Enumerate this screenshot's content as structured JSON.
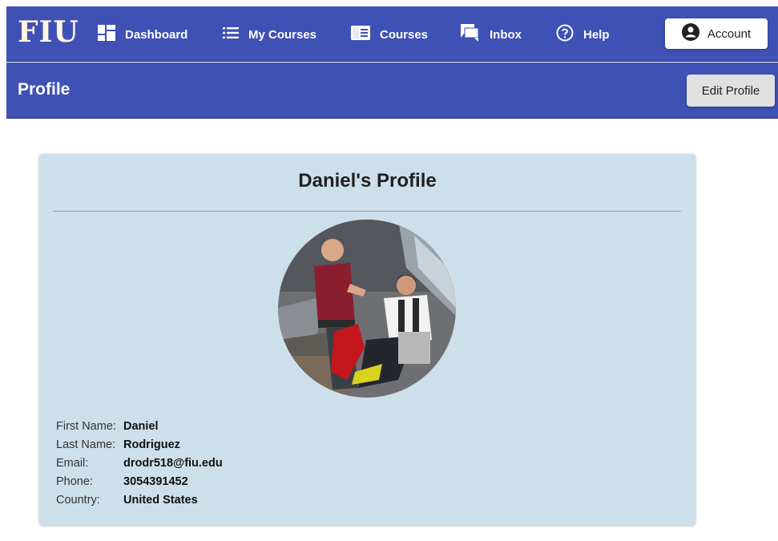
{
  "header": {
    "logo": "FIU",
    "nav": [
      {
        "label": "Dashboard",
        "icon": "dashboard-icon"
      },
      {
        "label": "My Courses",
        "icon": "list-icon"
      },
      {
        "label": "Courses",
        "icon": "courses-icon"
      },
      {
        "label": "Inbox",
        "icon": "inbox-icon"
      },
      {
        "label": "Help",
        "icon": "help-icon"
      }
    ],
    "account_label": "Account"
  },
  "subheader": {
    "title": "Profile",
    "edit_label": "Edit Profile"
  },
  "profile": {
    "heading": "Daniel's Profile",
    "photo": "profile-photo",
    "fields": [
      {
        "label": "First Name:",
        "value": "Daniel"
      },
      {
        "label": "Last Name:",
        "value": "Rodriguez"
      },
      {
        "label": "Email:",
        "value": "drodr518@fiu.edu"
      },
      {
        "label": "Phone:",
        "value": "3054391452"
      },
      {
        "label": "Country:",
        "value": "United States"
      }
    ]
  },
  "colors": {
    "primary": "#3f51b5",
    "card": "#cddfeb",
    "logo": "#fff8e1"
  }
}
